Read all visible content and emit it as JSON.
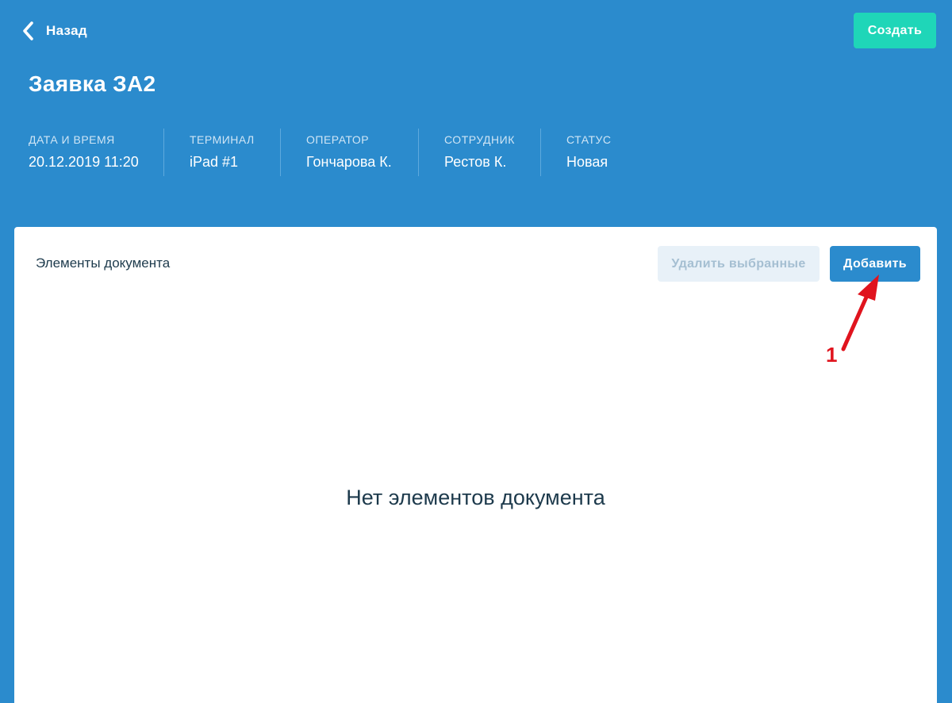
{
  "header": {
    "back_label": "Назад",
    "create_label": "Создать",
    "title": "Заявка ЗА2"
  },
  "meta": [
    {
      "label": "ДАТА И ВРЕМЯ",
      "value": "20.12.2019 11:20"
    },
    {
      "label": "ТЕРМИНАЛ",
      "value": "iPad #1"
    },
    {
      "label": "ОПЕРАТОР",
      "value": "Гончарова К."
    },
    {
      "label": "СОТРУДНИК",
      "value": "Рестов К."
    },
    {
      "label": "СТАТУС",
      "value": "Новая"
    }
  ],
  "panel": {
    "title": "Элементы документа",
    "delete_label": "Удалить выбранные",
    "add_label": "Добавить",
    "empty_message": "Нет элементов документа"
  },
  "annotation": {
    "number": "1",
    "color": "#e0141e"
  },
  "colors": {
    "background": "#2b8bcd",
    "accent": "#1fd6b8",
    "panel": "#ffffff",
    "disabled_button": "#e8f1f8",
    "primary_button": "#2b8bcd"
  },
  "icons": {
    "back": "chevron-left-icon"
  }
}
